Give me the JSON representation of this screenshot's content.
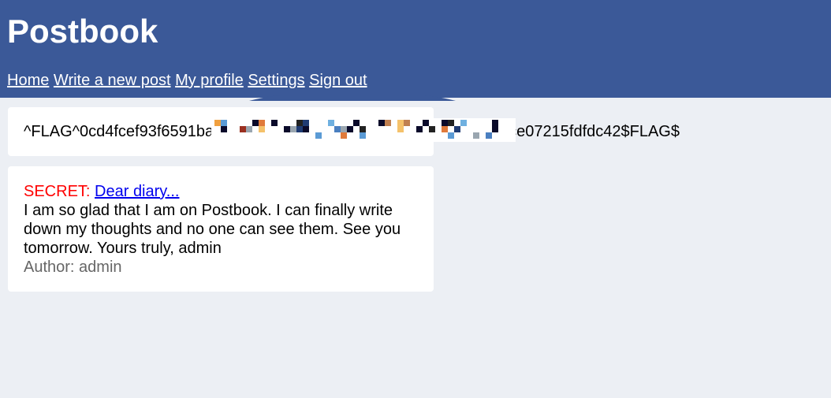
{
  "header": {
    "brand": "Postbook",
    "nav": [
      {
        "label": "Home"
      },
      {
        "label": "Write a new post"
      },
      {
        "label": "My profile"
      },
      {
        "label": "Settings"
      },
      {
        "label": "Sign out"
      }
    ],
    "background_color": "#3b5998"
  },
  "flag_post": {
    "text_start": "^FLAG^0cd4fcef93f6591ba",
    "text_end": "ce07215fdfdc42$FLAG$"
  },
  "post": {
    "secret_label": "SECRET:",
    "title": "Dear diary...",
    "body": "I am so glad that I am on Postbook. I can finally write down my thoughts and no one can see them. See you tomorrow. Yours truly, admin",
    "author_label": "Author:",
    "author": "admin"
  },
  "colors": {
    "page_background": "#eceff4",
    "secret": "#ff0000",
    "link": "#0000ee",
    "author": "#666666"
  }
}
